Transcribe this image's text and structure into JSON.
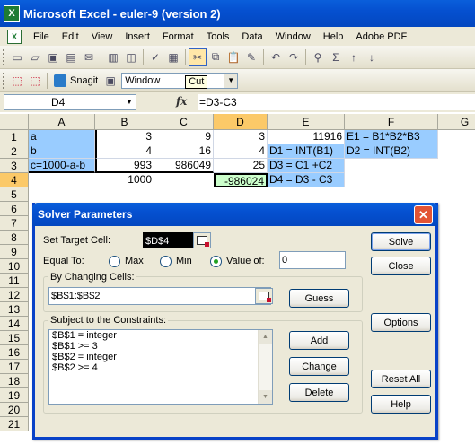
{
  "window": {
    "title": "Microsoft Excel - euler-9 (version 2)",
    "app_icon_text": "X"
  },
  "menu": [
    "File",
    "Edit",
    "View",
    "Insert",
    "Format",
    "Tools",
    "Data",
    "Window",
    "Help",
    "Adobe PDF"
  ],
  "toolbar2": {
    "snagit_label": "Snagit",
    "window_combo": "Window",
    "tooltip": "Cut"
  },
  "formula_bar": {
    "name_box": "D4",
    "fx": "fx",
    "formula": "=D3-C3"
  },
  "grid": {
    "columns": [
      "A",
      "B",
      "C",
      "D",
      "E",
      "F",
      "G"
    ],
    "rows": [
      "1",
      "2",
      "3",
      "4",
      "5",
      "6",
      "7",
      "8",
      "9",
      "10",
      "11",
      "12",
      "13",
      "14",
      "15",
      "16",
      "17",
      "18",
      "19",
      "20",
      "21"
    ],
    "cells": {
      "A1": "a",
      "B1": "3",
      "C1": "9",
      "D1": "3",
      "E1": "11916",
      "F1": "E1 = B1*B2*B3",
      "A2": "b",
      "B2": "4",
      "C2": "16",
      "D2": "4",
      "E2": "D1 = INT(B1)",
      "F2": "D2 = INT(B2)",
      "A3": "c=1000-a-b",
      "B3": "993",
      "C3": "986049",
      "D3": "25",
      "E3": "D3 = C1 +C2",
      "B4": "1000",
      "D4": "-986024",
      "E4": "D4 = D3 - C3"
    }
  },
  "dialog": {
    "title": "Solver Parameters",
    "set_target_label": "Set Target Cell:",
    "target_value": "$D$4",
    "equal_to_label": "Equal To:",
    "opt_max": "Max",
    "opt_min": "Min",
    "opt_value": "Value of:",
    "value_of": "0",
    "changing_label": "By Changing Cells:",
    "changing_value": "$B$1:$B$2",
    "constraints_label": "Subject to the Constraints:",
    "constraints": [
      "$B$1 = integer",
      "$B$1 >= 3",
      "$B$2 = integer",
      "$B$2 >= 4"
    ],
    "btn_solve": "Solve",
    "btn_close": "Close",
    "btn_guess": "Guess",
    "btn_options": "Options",
    "btn_add": "Add",
    "btn_change": "Change",
    "btn_delete": "Delete",
    "btn_reset": "Reset All",
    "btn_help": "Help"
  }
}
